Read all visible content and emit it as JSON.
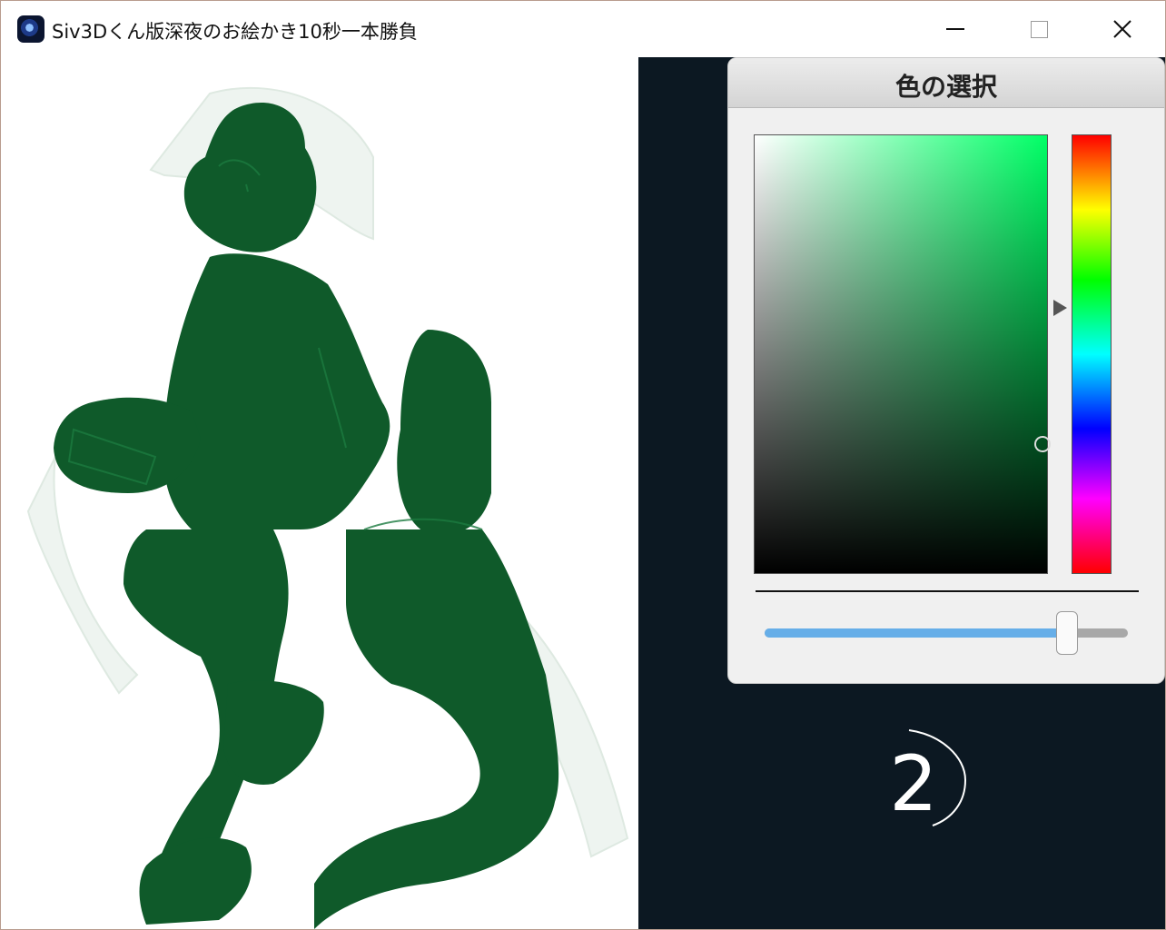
{
  "window": {
    "title": "Siv3Dくん版深夜のお絵かき10秒一本勝負",
    "controls": {
      "minimize": "minimize",
      "maximize": "maximize",
      "close": "close"
    }
  },
  "color_picker": {
    "title": "色の選択",
    "selected_color": "#146233",
    "hue_color": "#00ff66",
    "brightness_fraction": 0.83
  },
  "countdown": {
    "value": "2"
  },
  "colors": {
    "drawing": "#0d5a28",
    "background_dark": "#0c1822",
    "slider_fill": "#66aee8"
  }
}
